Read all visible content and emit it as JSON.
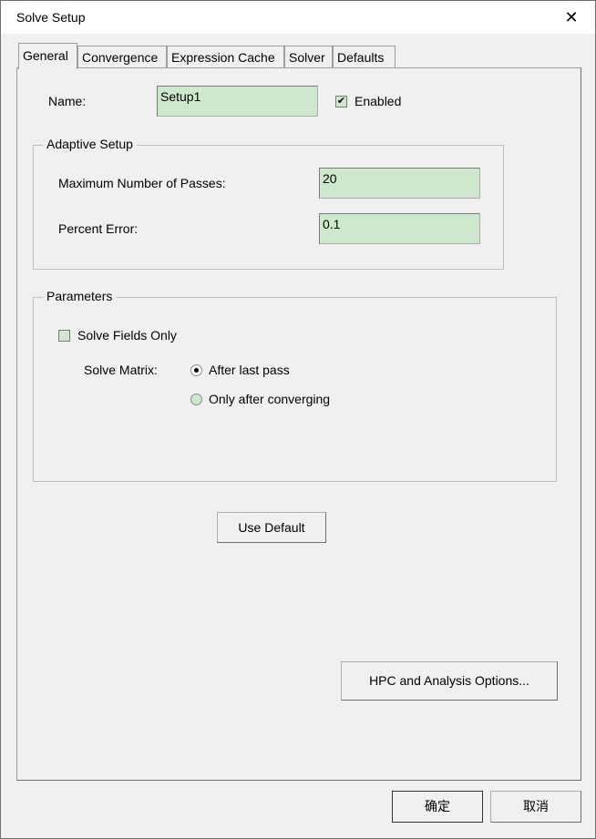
{
  "window": {
    "title": "Solve Setup"
  },
  "tabs": [
    "General",
    "Convergence",
    "Expression Cache",
    "Solver",
    "Defaults"
  ],
  "general": {
    "name_label": "Name:",
    "name_value": "Setup1",
    "enabled_label": "Enabled",
    "enabled_checked": true
  },
  "adaptive": {
    "title": "Adaptive Setup",
    "max_passes_label": "Maximum Number of Passes:",
    "max_passes_value": "20",
    "percent_error_label": "Percent Error:",
    "percent_error_value": "0.1"
  },
  "parameters": {
    "title": "Parameters",
    "solve_fields_only_label": "Solve Fields Only",
    "solve_fields_only_checked": false,
    "solve_matrix_label": "Solve Matrix:",
    "options": [
      {
        "label": "After last pass",
        "selected": true
      },
      {
        "label": "Only after converging",
        "selected": false
      }
    ]
  },
  "buttons": {
    "use_default": "Use Default",
    "hpc": "HPC and Analysis Options...",
    "ok": "确定",
    "cancel": "取消"
  },
  "colors": {
    "field_bg": "#cde8cc",
    "dialog_bg": "#f0f0f0"
  }
}
